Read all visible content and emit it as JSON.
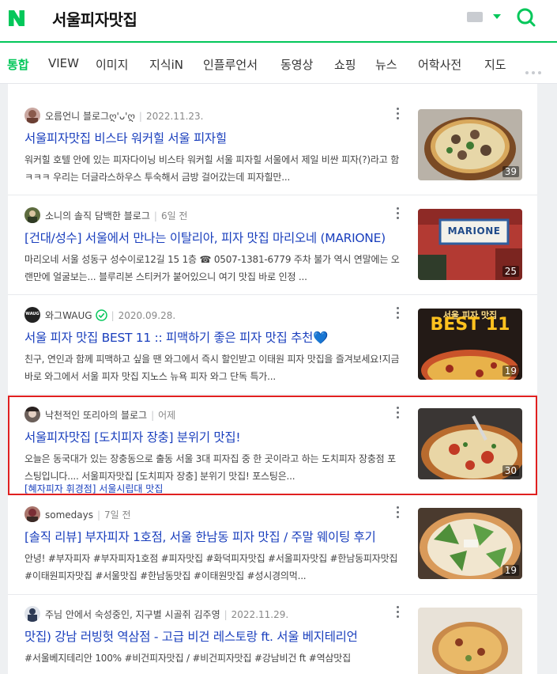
{
  "header": {
    "query": "서울피자맛집",
    "brand_color": "#03c75a"
  },
  "tabs": [
    "통합",
    "VIEW",
    "이미지",
    "지식iN",
    "인플루언서",
    "동영상",
    "쇼핑",
    "뉴스",
    "어학사전",
    "지도"
  ],
  "results": [
    {
      "author": "오름언니 블로그ღ'ᴗ'ღ",
      "date": "2022.11.23.",
      "title": "서울피자맛집 비스타 워커힐 서울 피자힐",
      "desc": "워커힐 호텔 안에 있는 피자다이닝 비스타 워커힐 서울 피자힐 서울에서 제일 비싼 피자(?)라고 함ㅋㅋㅋ 우리는 더글라스하우스 투숙해서 금방 걸어갔는데 피자힐만...",
      "image_count": "39"
    },
    {
      "author": "소니의 솔직 담백한 블로그",
      "date": "6일 전",
      "title": "[건대/성수] 서울에서 만나는 이탈리아, 피자 맛집 마리오네 (MARIONE)",
      "desc": "마리오네 서울 성동구 성수이로12길 15 1층 ☎ 0507-1381-6779 주차 불가 역시 연말에는 오랜만에 얼굴보는... 블루리본 스티커가 붙어있으니 여기 맛집 바로 인정 ...",
      "image_count": "25",
      "image_sign": "MARIONE"
    },
    {
      "author": "와그WAUG",
      "date": "2020.09.28.",
      "title": "서울 피자 맛집 BEST 11 :: 피맥하기 좋은 피자 맛집 추천💙",
      "desc": "친구, 연인과 함께 피맥하고 싶을 땐 와그에서 즉시 할인받고 이태원 피자 맛집을 즐겨보세요!지금 바로 와그에서 서울 피자 맛집 지노스 뉴욕 피자 와그 단독 특가...",
      "image_count": "19",
      "image_text": "BEST 11",
      "image_subtext": "서울 피자 맛집",
      "logo_text": "WAUG"
    },
    {
      "author": "낙천적인 또리아의 블로그",
      "date": "어제",
      "title": "서울피자맛집 [도치피자 장충] 분위기 맛집!",
      "desc": "오늘은 동국대가 있는 장충동으로 출동 서울 3대 피자집 중 한 곳이라고 하는 도치피자 장충점 포스팅입니다.... 서울피자맛집 [도치피자 장충] 분위기 맛집! 포스팅은...",
      "tagline": "[혜자피자 휘경점] 서울시립대 맛집",
      "image_count": "30"
    },
    {
      "author": "somedays",
      "date": "7일 전",
      "title": "[솔직 리뷰] 부자피자 1호점, 서울 한남동 피자 맛집 / 주말 웨이팅 후기",
      "desc": "안녕! #부자피자 #부자피자1호점 #피자맛집 #화덕피자맛집 #서울피자맛집 #한남동피자맛집 #이태원피자맛집 #서울맛집 #한남동맛집 #이태원맛집 #성시경의먹...",
      "image_count": "19"
    },
    {
      "author": "주님 안에서 숙성중인, 지구별 시골쥐 김주영",
      "date": "2022.11.29.",
      "title": "맛집) 강남 러빙헛 역삼점 - 고급 비건 레스토랑 ft. 서울 베지테리언",
      "desc": "#서울베지테리안 100% #비건피자맛집 / #비건피자맛집 #강남비건 ft #역삼맛집",
      "image_count": ""
    }
  ]
}
